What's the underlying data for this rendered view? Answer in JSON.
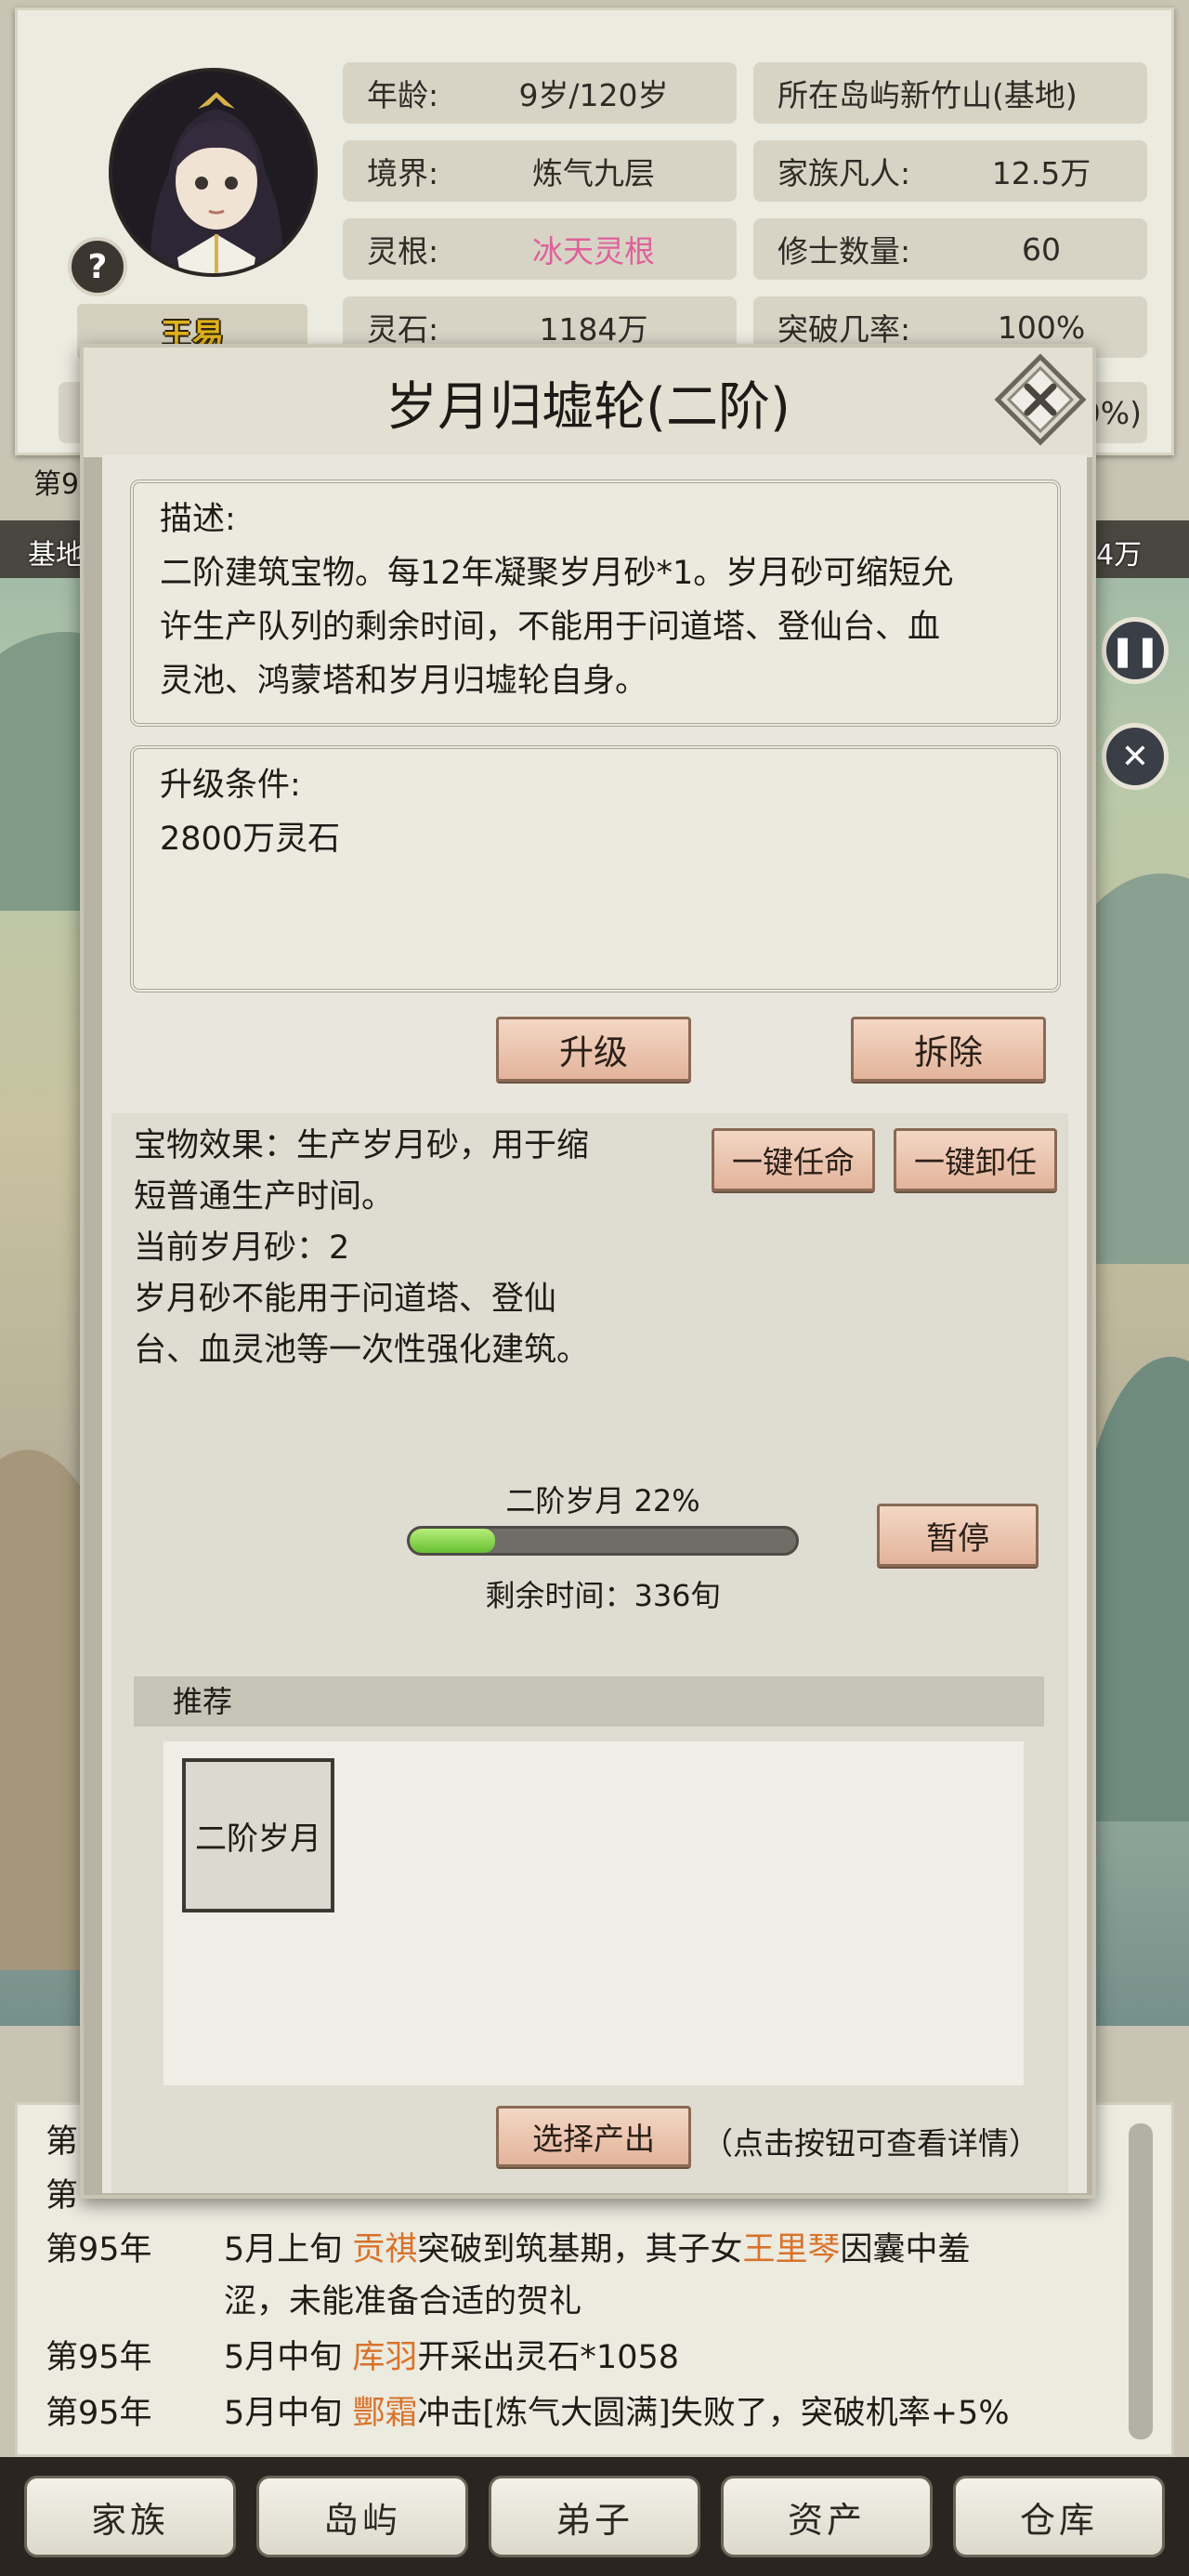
{
  "profile": {
    "name": "王易",
    "help_icon": "question-mark-icon",
    "stats_left": [
      {
        "label": "年龄:",
        "value": "9岁/120岁"
      },
      {
        "label": "境界:",
        "value": "炼气九层"
      },
      {
        "label": "灵根:",
        "value": "冰天灵根"
      },
      {
        "label": "灵石:",
        "value": "1184万"
      }
    ],
    "stats_right": [
      {
        "label": "所在岛屿",
        "value": "新竹山(基地)"
      },
      {
        "label": "家族凡人:",
        "value": "12.5万"
      },
      {
        "label": "修士数量:",
        "value": "60"
      },
      {
        "label": "突破几率:",
        "value": "100%"
      }
    ],
    "partial_right": "0%)",
    "partial_left": "第9",
    "partial_base": "基地",
    "partial_count": "4万"
  },
  "modal": {
    "title": "岁月归墟轮(二阶)",
    "description_label": "描述:",
    "description_text": "二阶建筑宝物。每12年凝聚岁月砂*1。岁月砂可缩短允许生产队列的剩余时间，不能用于问道塔、登仙台、血灵池、鸿蒙塔和岁月归墟轮自身。",
    "description_lines": [
      "二阶建筑宝物。每12年凝聚岁月砂*1。岁月砂可缩短允",
      "许生产队列的剩余时间，不能用于问道塔、登仙台、血",
      "灵池、鸿蒙塔和岁月归墟轮自身。"
    ],
    "upgrade_label": "升级条件:",
    "upgrade_cost": "2800万灵石",
    "upgrade_button": "升级",
    "demolish_button": "拆除",
    "effect_lines": [
      "宝物效果：生产岁月砂，用于缩",
      "短普通生产时间。",
      "当前岁月砂：2",
      "岁月砂不能用于问道塔、登仙",
      "台、血灵池等一次性强化建筑。"
    ],
    "appoint_all_button": "一键任命",
    "dismiss_all_button": "一键卸任",
    "production": {
      "label": "二阶岁月 22%",
      "progress": 0.22,
      "remaining": "剩余时间：336旬",
      "pause_button": "暂停"
    },
    "recommend_header": "推荐",
    "recommend_item": "二阶岁月",
    "select_output_button": "选择产出",
    "select_output_hint": "（点击按钮可查看详情）"
  },
  "log": {
    "rows": [
      {
        "year": "第95年",
        "parts": [
          "5月上旬 ",
          "贡祺",
          "突破到筑基期，其子女",
          "王里琴",
          "因囊中羞"
        ]
      },
      {
        "year": "",
        "parts": [
          "涩，未能准备合适的贺礼"
        ]
      },
      {
        "year": "第95年",
        "parts": [
          "5月中旬 ",
          "库羽",
          "开采出灵石*1058"
        ]
      },
      {
        "year": "第95年",
        "parts": [
          "5月中旬 ",
          "酆霜",
          "冲击[炼气大圆满]失败了，突破机率+5%"
        ]
      }
    ],
    "partial_rows": [
      "第",
      "第"
    ]
  },
  "nav": [
    "家族",
    "岛屿",
    "弟子",
    "资产",
    "仓库"
  ],
  "colors": {
    "highlight": "#d9722a",
    "pink_value": "#e0609a",
    "name_gold": "#e0b21c"
  }
}
